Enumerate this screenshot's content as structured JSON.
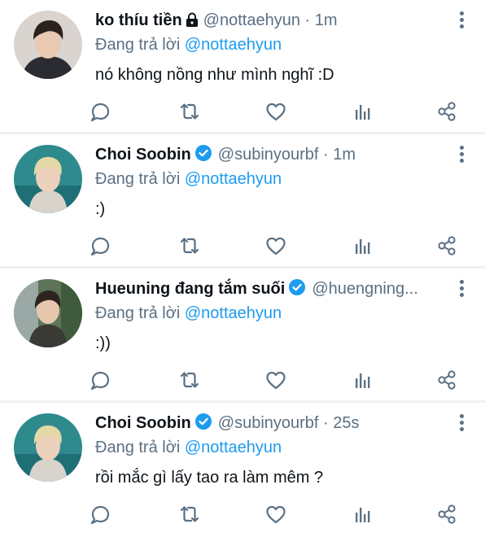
{
  "colors": {
    "accent": "#1d9bf0",
    "secondary_text": "#5b7083",
    "primary_text": "#0f1419",
    "divider": "#eef1f3"
  },
  "icons": {
    "reply": "reply-icon",
    "retweet": "retweet-icon",
    "like": "heart-icon",
    "analytics": "analytics-icon",
    "share": "share-icon",
    "more": "more-vertical-icon",
    "lock": "lock-icon",
    "verified": "verified-badge-icon"
  },
  "tweets": [
    {
      "name": "ko thíu tiền",
      "handle": "@nottaehyun",
      "dot": "·",
      "time": "1m",
      "reply_prefix": "Đang trả lời",
      "reply_to": "@nottaehyun",
      "text": "nó không nồng như mình nghĩ :D"
    },
    {
      "name": "Choi Soobin",
      "handle": "@subinyourbf",
      "dot": "·",
      "time": "1m",
      "reply_prefix": "Đang trả lời",
      "reply_to": "@nottaehyun",
      "text": ":)"
    },
    {
      "name": "Hueuning đang tắm suối",
      "handle": "@huengning...",
      "dot": "",
      "time": "",
      "reply_prefix": "Đang trả lời",
      "reply_to": "@nottaehyun",
      "text": ":))"
    },
    {
      "name": "Choi Soobin",
      "handle": "@subinyourbf",
      "dot": "·",
      "time": "25s",
      "reply_prefix": "Đang trả lời",
      "reply_to": "@nottaehyun",
      "text": "rồi mắc gì lấy tao ra làm mêm ?"
    }
  ]
}
